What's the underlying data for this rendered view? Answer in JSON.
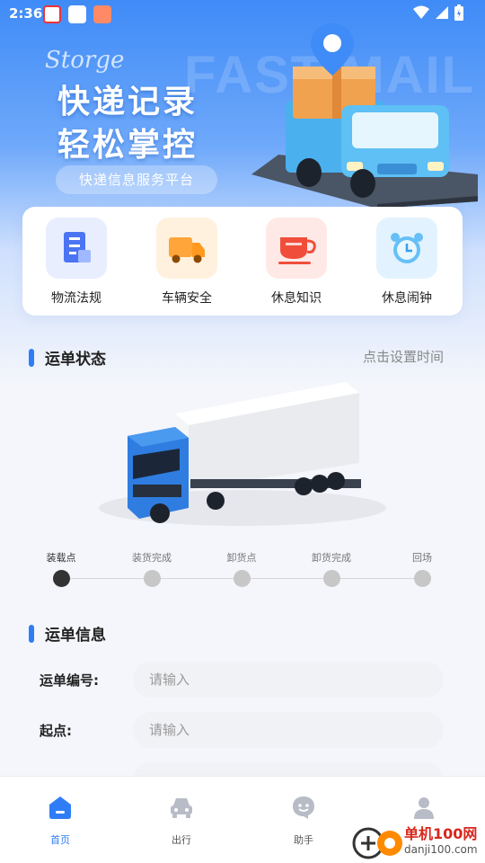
{
  "status_bar": {
    "time": "2:36"
  },
  "hero": {
    "bg_word": "FAST MAIL",
    "script_word": "Storge",
    "headline_1": "快递记录",
    "headline_2": "轻松掌控",
    "subtitle": "快递信息服务平台"
  },
  "quick_actions": [
    {
      "label": "物流法规",
      "icon": "document-icon"
    },
    {
      "label": "车辆安全",
      "icon": "truck-icon"
    },
    {
      "label": "休息知识",
      "icon": "cup-icon"
    },
    {
      "label": "休息闹钟",
      "icon": "alarm-clock-icon"
    }
  ],
  "waybill_status": {
    "title": "运单状态",
    "set_time_link": "点击设置时间",
    "steps": [
      "装载点",
      "装货完成",
      "卸货点",
      "卸货完成",
      "回场"
    ],
    "active_step": 0
  },
  "waybill_info": {
    "title": "运单信息",
    "fields": [
      {
        "label": "运单编号:",
        "placeholder": "请输入"
      },
      {
        "label": "起点:",
        "placeholder": "请输入"
      }
    ]
  },
  "tabbar": {
    "tabs": [
      {
        "label": "首页",
        "icon": "home-icon"
      },
      {
        "label": "出行",
        "icon": "car-icon"
      },
      {
        "label": "助手",
        "icon": "assistant-icon"
      },
      {
        "label": "",
        "icon": "user-icon"
      }
    ],
    "active_tab": 0
  },
  "watermark": {
    "name": "单机100网",
    "url": "danji100.com"
  },
  "colors": {
    "accent": "#2f7df6",
    "hero_top": "#3f8bf7",
    "inactive_icon": "#b8bcc6"
  }
}
